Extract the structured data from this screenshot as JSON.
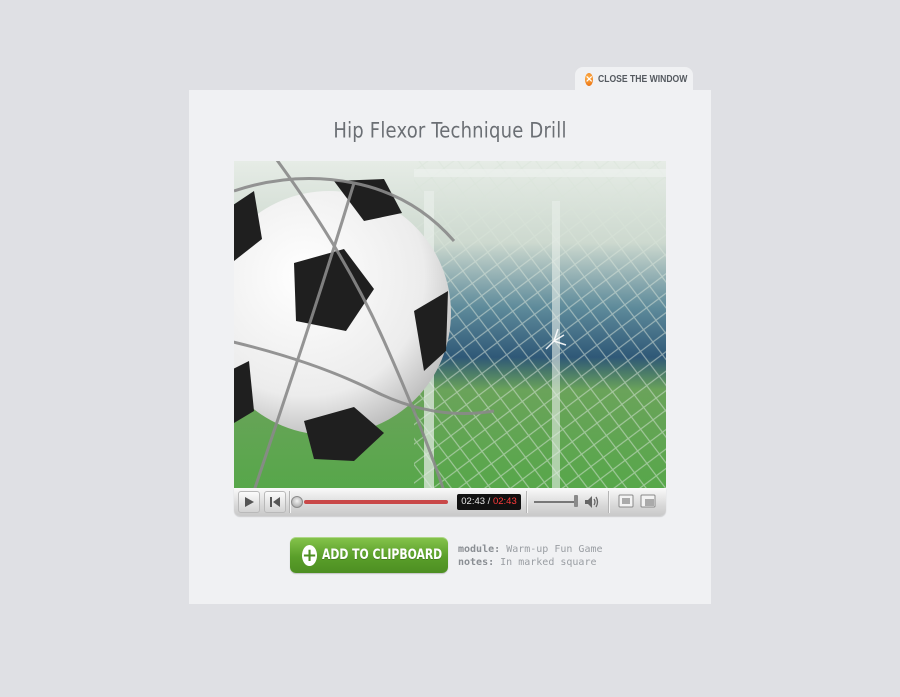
{
  "window": {
    "close_label": "CLOSE THE WINDOW",
    "title": "Hip Flexor Technique Drill"
  },
  "video": {
    "subject": "soccer ball hitting goal net",
    "current_time": "02:43",
    "separator": "/",
    "total_time": "02:43",
    "progress_percent": 100,
    "volume_percent": 90
  },
  "actions": {
    "add_to_clipboard_label": "ADD TO CLIPBOARD"
  },
  "meta": {
    "module_key": "module:",
    "module_value": "Warm-up Fun Game",
    "notes_key": "notes:",
    "notes_value": "In marked square"
  },
  "colors": {
    "accent_green": "#5a9f2a",
    "close_orange": "#e86a0c",
    "progress_red": "#c94848",
    "time_red": "#ff3b3b"
  }
}
